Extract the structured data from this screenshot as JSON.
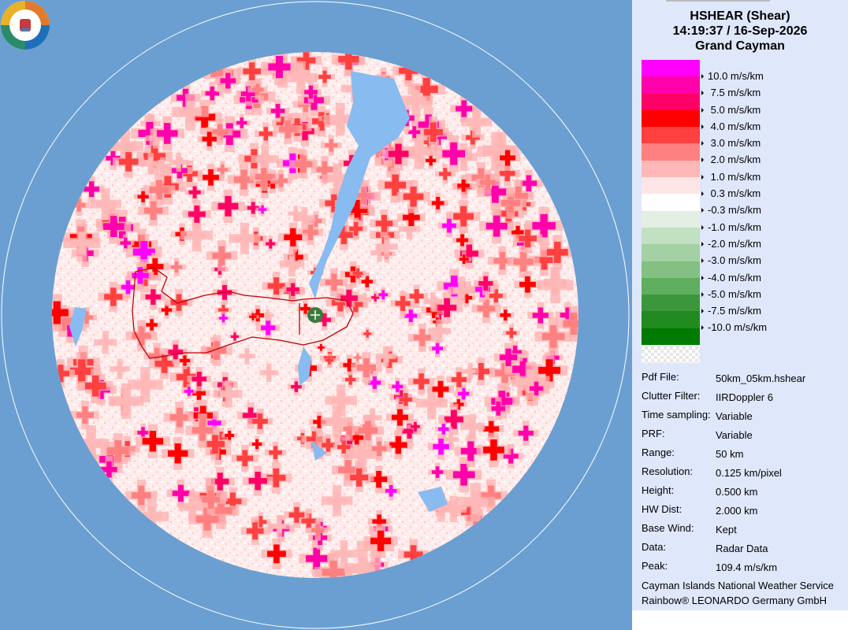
{
  "header": {
    "product": "HSHEAR (Shear)",
    "datetime": "14:19:37 / 16-Sep-2026",
    "site": "Grand Cayman"
  },
  "legend": [
    {
      "label": "10.0 m/s/km",
      "color": "#ff00ff"
    },
    {
      "label": " 7.5 m/s/km",
      "color": "#ff00aa"
    },
    {
      "label": " 5.0 m/s/km",
      "color": "#ff0066"
    },
    {
      "label": " 4.0 m/s/km",
      "color": "#ff0000"
    },
    {
      "label": " 3.0 m/s/km",
      "color": "#ff4040"
    },
    {
      "label": " 2.0 m/s/km",
      "color": "#ff8080"
    },
    {
      "label": " 1.0 m/s/km",
      "color": "#ffb8b8"
    },
    {
      "label": " 0.3 m/s/km",
      "color": "#ffe6e6"
    },
    {
      "label": "-0.3 m/s/km",
      "color": "#ffffff"
    },
    {
      "label": "-1.0 m/s/km",
      "color": "#e2efe2"
    },
    {
      "label": "-2.0 m/s/km",
      "color": "#c2e0c2"
    },
    {
      "label": "-3.0 m/s/km",
      "color": "#a3d1a3"
    },
    {
      "label": "-4.0 m/s/km",
      "color": "#84bf84"
    },
    {
      "label": "-5.0 m/s/km",
      "color": "#5fae5f"
    },
    {
      "label": "-7.5 m/s/km",
      "color": "#3c973c"
    },
    {
      "label": "-10.0 m/s/km",
      "color": "#218a21"
    },
    {
      "label": "",
      "color": "#007a00"
    }
  ],
  "info": [
    {
      "key": "Pdf File:",
      "value": "50km_05km.hshear"
    },
    {
      "key": "Clutter Filter:",
      "value": "IIRDoppler 6"
    },
    {
      "key": "Time sampling:",
      "value": "Variable"
    },
    {
      "key": "PRF:",
      "value": "Variable"
    },
    {
      "key": "Range:",
      "value": "50 km"
    },
    {
      "key": "Resolution:",
      "value": "0.125 km/pixel"
    },
    {
      "key": "Height:",
      "value": "0.500 km"
    },
    {
      "key": "HW Dist:",
      "value": "2.000 km"
    },
    {
      "key": "Base Wind:",
      "value": "Kept"
    },
    {
      "key": "Data:",
      "value": "Radar Data"
    },
    {
      "key": "Peak:",
      "value": "109.4 m/s/km"
    }
  ],
  "credits": {
    "line1": "Cayman Islands National Weather Service",
    "line2": "Rainbow® LEONARDO Germany GmbH"
  },
  "colors": {
    "background": "#6b9fd1",
    "panel": "#dfe7fb",
    "coastline": "#c00000",
    "water": "#88bbf0",
    "site_marker": "#3c7a3c"
  },
  "icons": {
    "radar_site": "radar-site-icon",
    "logo": "cayman-weather-service-logo"
  }
}
